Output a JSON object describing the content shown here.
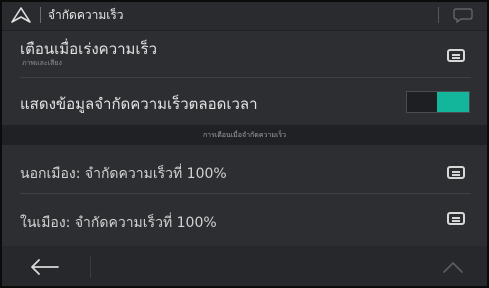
{
  "header": {
    "title": "จำกัดความเร็ว",
    "nav_icon": "navigation-arrow-icon",
    "chat_icon": "speech-bubble-icon"
  },
  "rows": [
    {
      "label": "เตือนเมื่อเร่งความเร็ว",
      "sublabel": "ภาพและเสียง"
    },
    {
      "label": "แสดงข้อมูลจำกัดความเร็วตลอดเวลา",
      "toggle_on": true
    },
    {
      "label": "นอกเมือง: จำกัดความเร็วที่ 100%"
    },
    {
      "label": "ในเมือง: จำกัดความเร็วที่ 100%"
    }
  ],
  "section_header": "การเตือนเมื่อจำกัดความเร็ว",
  "footer": {
    "back_icon": "back-arrow-icon",
    "up_icon": "chevron-up-icon"
  },
  "colors": {
    "background": "#2d2e31",
    "toggle_accent": "#13b59b"
  }
}
